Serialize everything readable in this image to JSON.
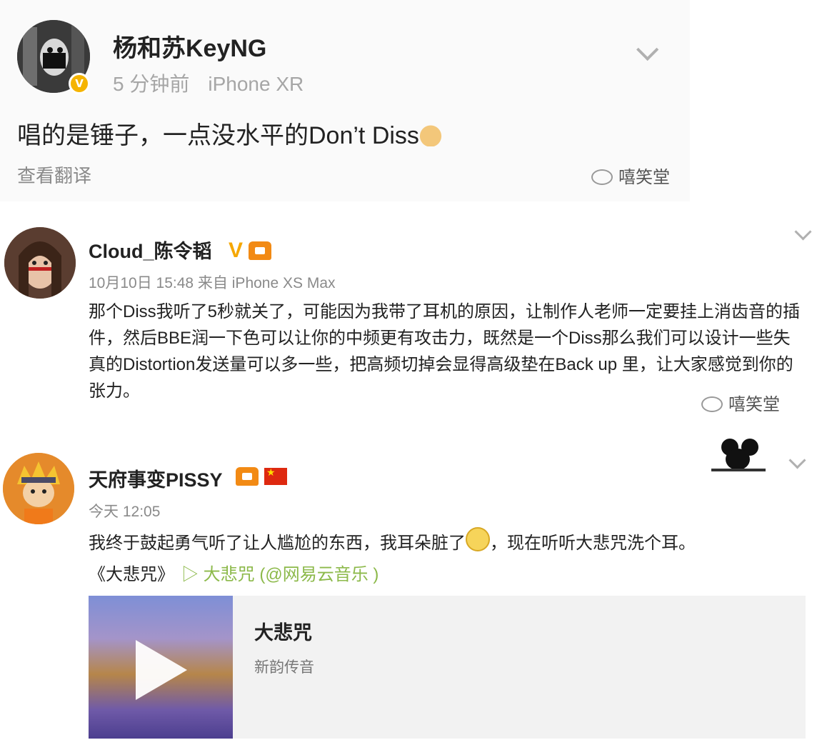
{
  "post1": {
    "username": "杨和苏KeyNG",
    "time": "5 分钟前",
    "device": "iPhone XR",
    "body": "唱的是锤子，一点没水平的Don’t Diss",
    "verified_icon": "v-badge-icon",
    "translate_label": "查看翻译",
    "watermark": "嘻笑堂"
  },
  "post2": {
    "username": "Cloud_陈令韬",
    "verified_mark": "V",
    "meta": "10月10日 15:48 来自 iPhone XS Max",
    "body": "那个Diss我听了5秒就关了，可能因为我带了耳机的原因，让制作人老师一定要挂上消齿音的插件，然后BBE润一下色可以让你的中频更有攻击力，既然是一个Diss那么我们可以设计一些失真的Distortion发送量可以多一些，把高频切掉会显得高级垫在Back up 里，让大家感觉到你的张力。",
    "watermark": "嘻笑堂"
  },
  "post3": {
    "username": "天府事变PISSY",
    "time": "今天 12:05",
    "body_part1": "我终于鼓起勇气听了让人尴尬的东西，我耳朵脏了",
    "body_part2": "，现在听听大悲咒洗个耳。",
    "link_title": "《大悲咒》",
    "link_play": "▷ 大悲咒 (@网易云音乐 )",
    "card": {
      "song": "大悲咒",
      "artist": "新韵传音"
    }
  },
  "colors": {
    "verified_gold": "#f5b400",
    "link_green": "#8cb94a",
    "meta_gray": "#a6a6a6"
  }
}
